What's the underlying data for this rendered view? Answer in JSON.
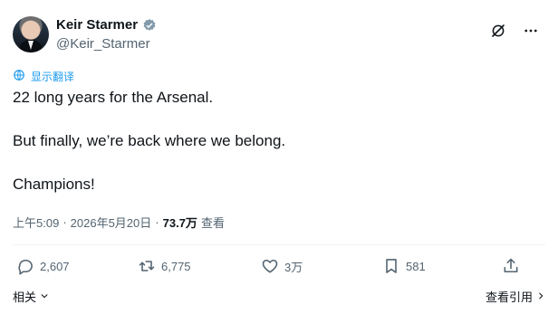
{
  "author": {
    "name": "Keir Starmer",
    "handle": "@Keir_Starmer"
  },
  "translate_label": "显示翻译",
  "tweet": {
    "lines": [
      "22 long years for the Arsenal.",
      "But finally, we’re back where we belong.",
      "Champions!"
    ]
  },
  "meta": {
    "time": "上午5:09",
    "separator": "·",
    "date": "2026年5月20日",
    "separator2": "·",
    "views": "73.7万",
    "views_label": "查看"
  },
  "actions": {
    "replies": "2,607",
    "reposts": "6,775",
    "likes": "3万",
    "bookmarks": "581"
  },
  "footer": {
    "related": "相关",
    "view_quotes": "查看引用"
  },
  "colors": {
    "accent": "#1d9bf0",
    "secondary_text": "#536471",
    "primary_text": "#0f1419"
  }
}
